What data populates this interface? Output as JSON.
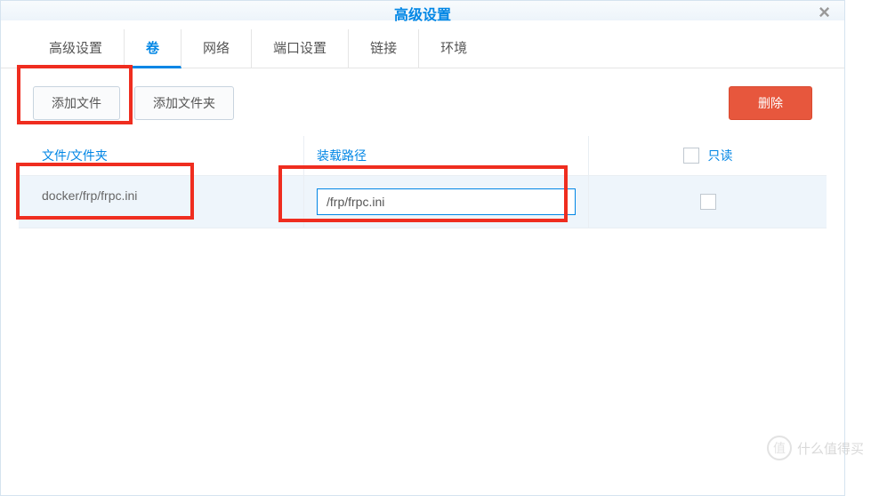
{
  "title": "高级设置",
  "tabs": [
    "高级设置",
    "卷",
    "网络",
    "端口设置",
    "链接",
    "环境"
  ],
  "active_tab_index": 1,
  "toolbar": {
    "add_file": "添加文件",
    "add_folder": "添加文件夹",
    "delete": "删除"
  },
  "columns": {
    "file": "文件/文件夹",
    "path": "装载路径",
    "readonly": "只读"
  },
  "rows": [
    {
      "file": "docker/frp/frpc.ini",
      "path": "/frp/frpc.ini",
      "readonly": false
    }
  ],
  "watermark": "什么值得买"
}
